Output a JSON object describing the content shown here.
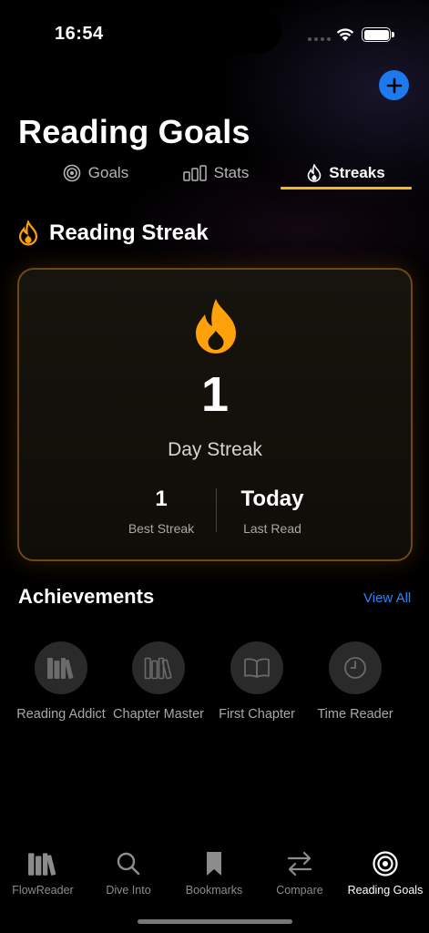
{
  "status_bar": {
    "time": "16:54"
  },
  "header": {
    "title": "Reading Goals"
  },
  "tabs": [
    {
      "label": "Goals",
      "icon": "target-icon",
      "active": false
    },
    {
      "label": "Stats",
      "icon": "bar-chart-icon",
      "active": false
    },
    {
      "label": "Streaks",
      "icon": "flame-icon",
      "active": true
    }
  ],
  "streak_section": {
    "title": "Reading Streak",
    "count": "1",
    "count_label": "Day Streak",
    "best_value": "1",
    "best_label": "Best Streak",
    "last_value": "Today",
    "last_label": "Last Read"
  },
  "achievements": {
    "title": "Achievements",
    "view_all": "View All",
    "items": [
      {
        "label": "Reading Addict",
        "icon": "books-icon"
      },
      {
        "label": "Chapter Master",
        "icon": "books-outline-icon"
      },
      {
        "label": "First Chapter",
        "icon": "open-book-icon"
      },
      {
        "label": "Time Reader",
        "icon": "clock-icon"
      }
    ]
  },
  "tabbar": [
    {
      "label": "FlowReader",
      "icon": "books-icon",
      "active": false
    },
    {
      "label": "Dive Into",
      "icon": "search-icon",
      "active": false
    },
    {
      "label": "Bookmarks",
      "icon": "bookmark-icon",
      "active": false
    },
    {
      "label": "Compare",
      "icon": "swap-arrows-icon",
      "active": false
    },
    {
      "label": "Reading Goals",
      "icon": "target-icon",
      "active": true
    }
  ],
  "colors": {
    "accent": "#f5b820",
    "flame": "#ffa10a",
    "link": "#2a86f7",
    "add_button": "#1e78f0"
  }
}
